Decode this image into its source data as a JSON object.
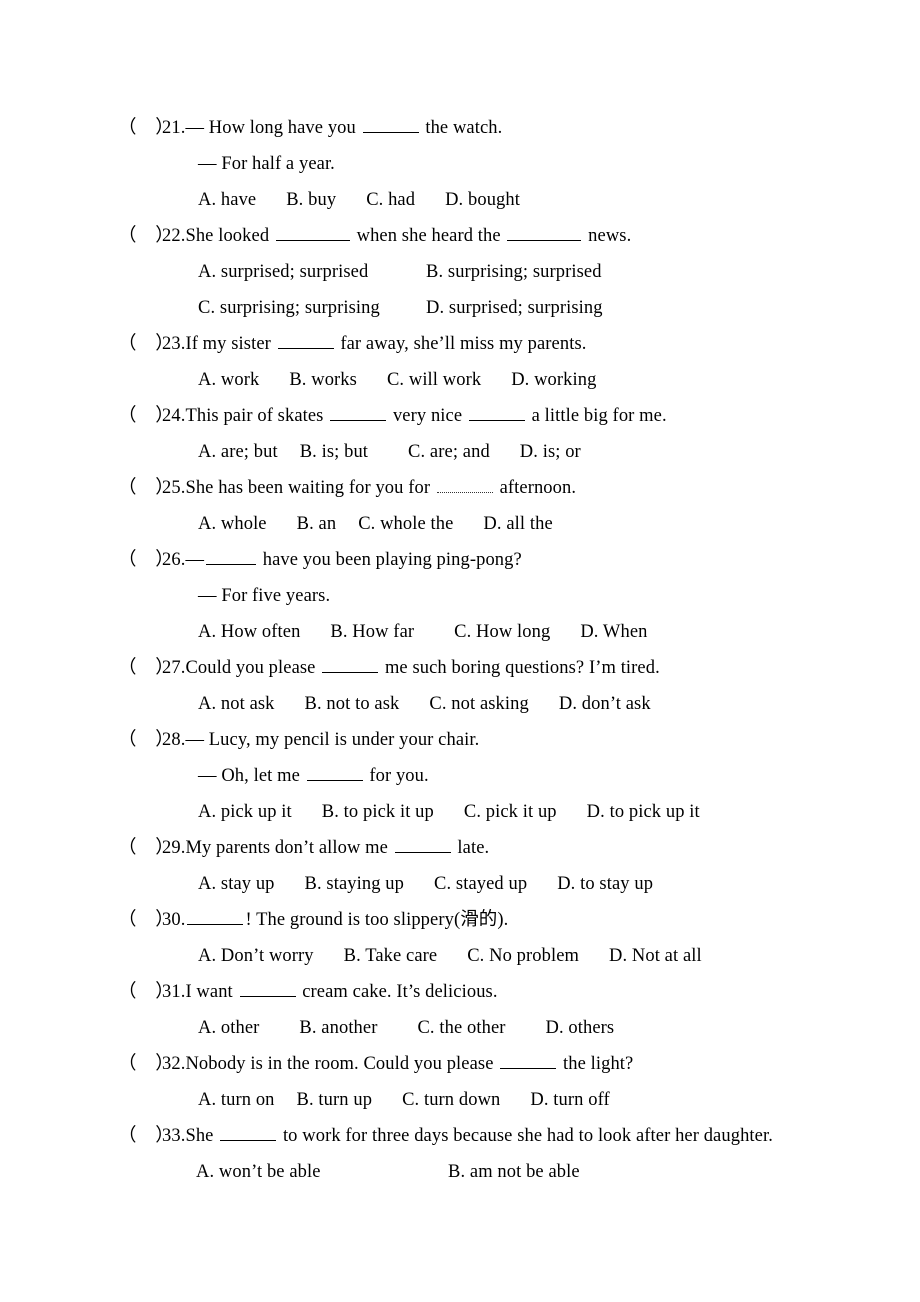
{
  "document": {
    "type": "multiple-choice-worksheet",
    "marker": "(    )",
    "blank_placeholder": "______"
  },
  "questions": [
    {
      "number": "21.",
      "stem_pre": "— How long have you ",
      "stem_post": " the watch.",
      "continuation": "— For half a year.",
      "options_layout": "row",
      "options": [
        "A. have",
        "B. buy",
        "C. had",
        "D. bought"
      ]
    },
    {
      "number": "22.",
      "stem_pre": "She looked ",
      "stem_mid": " when she heard the ",
      "stem_post": " news.",
      "options_layout": "grid2",
      "options": [
        "A. surprised; surprised",
        "B. surprising; surprised",
        "C. surprising; surprising",
        "D. surprised; surprising"
      ]
    },
    {
      "number": "23.",
      "stem_pre": "If my sister ",
      "stem_post": " far away, she’ll miss my parents.",
      "options_layout": "row",
      "options": [
        "A. work",
        "B. works",
        "C. will work",
        "D. working"
      ]
    },
    {
      "number": "24.",
      "stem_pre": "This pair of skates ",
      "stem_mid": " very nice ",
      "stem_post": " a little big for me.",
      "options_layout": "row",
      "options": [
        "A. are; but",
        "B. is; but",
        "C. are; and",
        "D. is; or"
      ]
    },
    {
      "number": "25.",
      "stem_pre": "She has been waiting for you for ",
      "stem_post": " afternoon.",
      "options_layout": "row",
      "options": [
        "A. whole",
        "B. an",
        "C. whole the",
        "D. all the"
      ]
    },
    {
      "number": "26.",
      "stem_pre": "—",
      "stem_post": " have you been playing ping-pong?",
      "continuation": "— For five years.",
      "options_layout": "row",
      "options": [
        "A. How often",
        "B. How far",
        "C. How long",
        "D. When"
      ]
    },
    {
      "number": "27.",
      "stem_pre": "Could you please ",
      "stem_post": " me such boring questions? I’m tired.",
      "options_layout": "row",
      "options": [
        "A. not ask",
        "B. not to ask",
        "C. not asking",
        "D. don’t ask"
      ]
    },
    {
      "number": "28.",
      "stem_pre": "— Lucy, my pencil is under your chair.",
      "continuation_pre": "— Oh, let me ",
      "continuation_post": " for you.",
      "options_layout": "row",
      "options": [
        "A. pick up it",
        "B. to pick it up",
        "C. pick it up",
        "D. to pick up it"
      ]
    },
    {
      "number": "29.",
      "stem_pre": "My parents don’t allow me ",
      "stem_post": " late.",
      "options_layout": "row",
      "options": [
        "A. stay up",
        "B. staying up",
        "C. stayed up",
        "D. to stay up"
      ]
    },
    {
      "number": "30.",
      "stem_pre": "",
      "stem_post": "! The ground is too slippery(滑的).",
      "options_layout": "row",
      "options": [
        "A. Don’t worry",
        "B. Take care",
        "C. No problem",
        "D. Not at all"
      ]
    },
    {
      "number": "31.",
      "stem_pre": "I want ",
      "stem_post": " cream cake. It’s delicious.",
      "options_layout": "row",
      "options": [
        "A. other",
        "B. another",
        "C. the other",
        "D. others"
      ]
    },
    {
      "number": "32.",
      "stem_pre": "Nobody is in the room. Could you please ",
      "stem_post": " the light?",
      "options_layout": "row",
      "options": [
        "A. turn on",
        "B. turn up",
        "C. turn down",
        "D. turn off"
      ]
    },
    {
      "number": "33.",
      "stem_pre": "She ",
      "stem_post": " to work for three days because she had to look after her daughter.",
      "options_layout": "grid2",
      "options": [
        "A. won’t be able",
        "B. am not be able"
      ]
    }
  ]
}
